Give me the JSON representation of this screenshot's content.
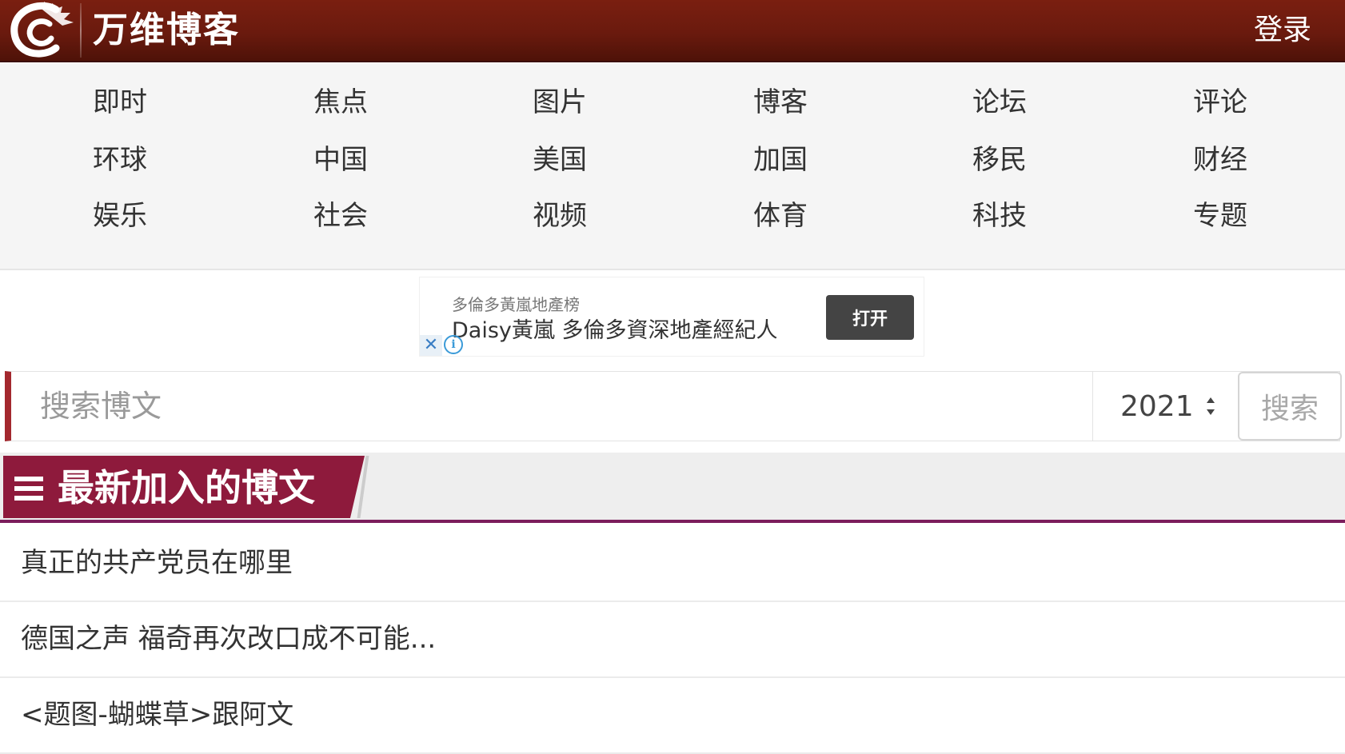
{
  "header": {
    "site_title": "万维博客",
    "login_label": "登录",
    "background_color": "#6a1a0e"
  },
  "nav": {
    "rows": [
      [
        "即时",
        "焦点",
        "图片",
        "博客",
        "论坛",
        "评论"
      ],
      [
        "环球",
        "中国",
        "美国",
        "加国",
        "移民",
        "财经"
      ],
      [
        "娱乐",
        "社会",
        "视频",
        "体育",
        "科技",
        "专题"
      ]
    ]
  },
  "ad": {
    "subtitle": "多倫多黃嵐地產榜",
    "title": "Daisy黃嵐 多倫多資深地產經紀人",
    "button_label": "打开",
    "close_symbol": "✕",
    "info_symbol": "i"
  },
  "search": {
    "placeholder": "搜索博文",
    "year_value": "2021",
    "button_label": "搜索",
    "accent_color": "#a3282e"
  },
  "section": {
    "title": "最新加入的博文",
    "accent_color": "#8e1a3c"
  },
  "articles": [
    "真正的共产党员在哪里",
    "德国之声 福奇再次改口成不可能...",
    "<题图-蝴蝶草>跟阿文"
  ]
}
